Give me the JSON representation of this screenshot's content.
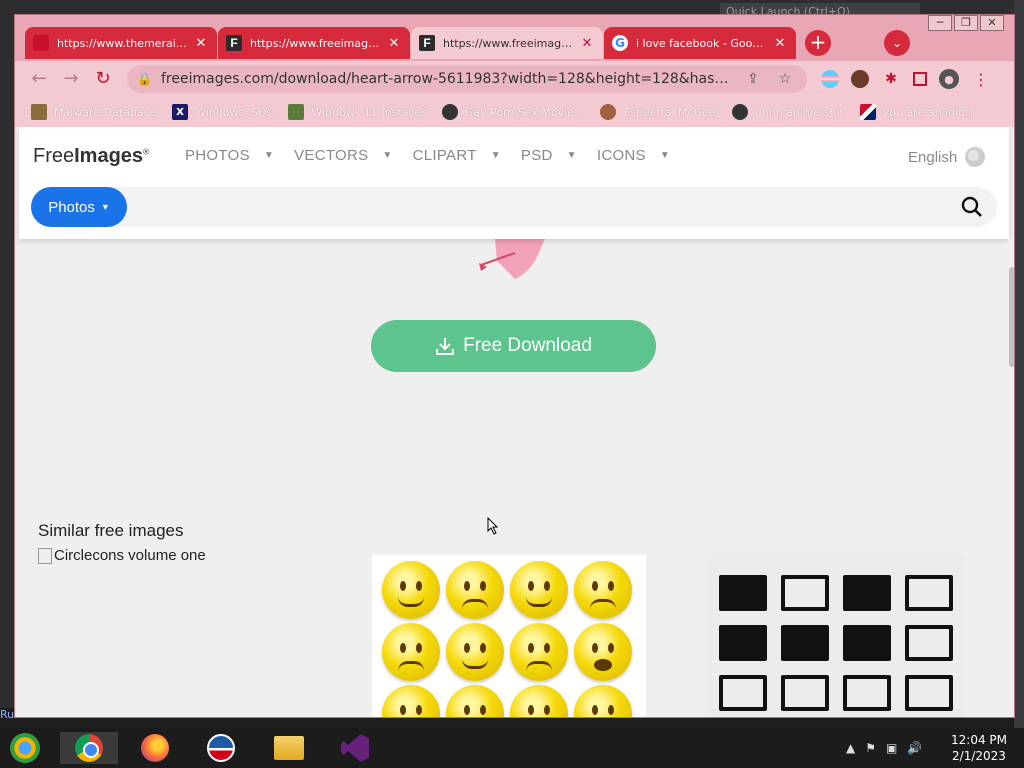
{
  "desktop": {
    "quicklaunch_placeholder": "Quick Launch (Ctrl+Q)",
    "run_label": "Ru"
  },
  "window": {
    "controls": {
      "minimize": "─",
      "restore": "❐",
      "close": "✕"
    }
  },
  "tabs": [
    {
      "title": "https://www.themeraide",
      "favicon": "youtube-icon",
      "style": "red"
    },
    {
      "title": "https://www.freeimages.",
      "favicon": "freeimages-icon",
      "style": "red"
    },
    {
      "title": "https://www.freeimages.",
      "favicon": "freeimages-icon",
      "style": "active"
    },
    {
      "title": "i love facebook - Google",
      "favicon": "google-icon",
      "style": "red"
    }
  ],
  "tab_close": "✕",
  "new_tab": "+",
  "tab_menu": "⌄",
  "toolbar": {
    "back": "←",
    "forward": "→",
    "reload": "↻",
    "url": "freeimages.com/download/heart-arrow-5611983?width=128&height=128&hash=f6e1b01...",
    "share": "⇪",
    "star": "☆",
    "menu": "⋮",
    "puzzle": "✱",
    "profile": "●"
  },
  "bookmarks": [
    {
      "label": "Malware Database",
      "icon": "malware-icon"
    },
    {
      "label": "Windows ISOs",
      "icon": "x-icon"
    },
    {
      "label": "Windows 11 Installer",
      "icon": "installer-icon"
    },
    {
      "label": "Gay Porn Sex Movie...",
      "icon": "site-icon"
    },
    {
      "label": "Espectral McGee",
      "icon": "avatar-icon"
    },
    {
      "label": "uhhh anime shit",
      "icon": "anime-icon"
    },
    {
      "label": "you are an idiot!",
      "icon": "uk-flag-icon"
    }
  ],
  "site": {
    "logo_light": "Free",
    "logo_bold": "Images",
    "logo_mark": "®",
    "nav": [
      "PHOTOS",
      "VECTORS",
      "CLIPART",
      "PSD",
      "ICONS"
    ],
    "language": "English",
    "search_category": "Photos",
    "search_placeholder": ""
  },
  "download": {
    "label": "Free Download"
  },
  "similar": {
    "heading": "Similar free images",
    "broken_alt": "Circlecons volume one"
  },
  "taskbar": {
    "apps": [
      "start-orb-icon",
      "chrome-icon",
      "firefox-icon",
      "obama-icon",
      "file-explorer-icon",
      "visual-studio-icon"
    ],
    "time": "12:04 PM",
    "date": "2/1/2023"
  },
  "colors": {
    "chrome_tab_red": "#d42a3b",
    "chrome_frame_pink": "#e9a6b4",
    "download_green": "#5cc48c",
    "photos_blue": "#1a73e8"
  }
}
